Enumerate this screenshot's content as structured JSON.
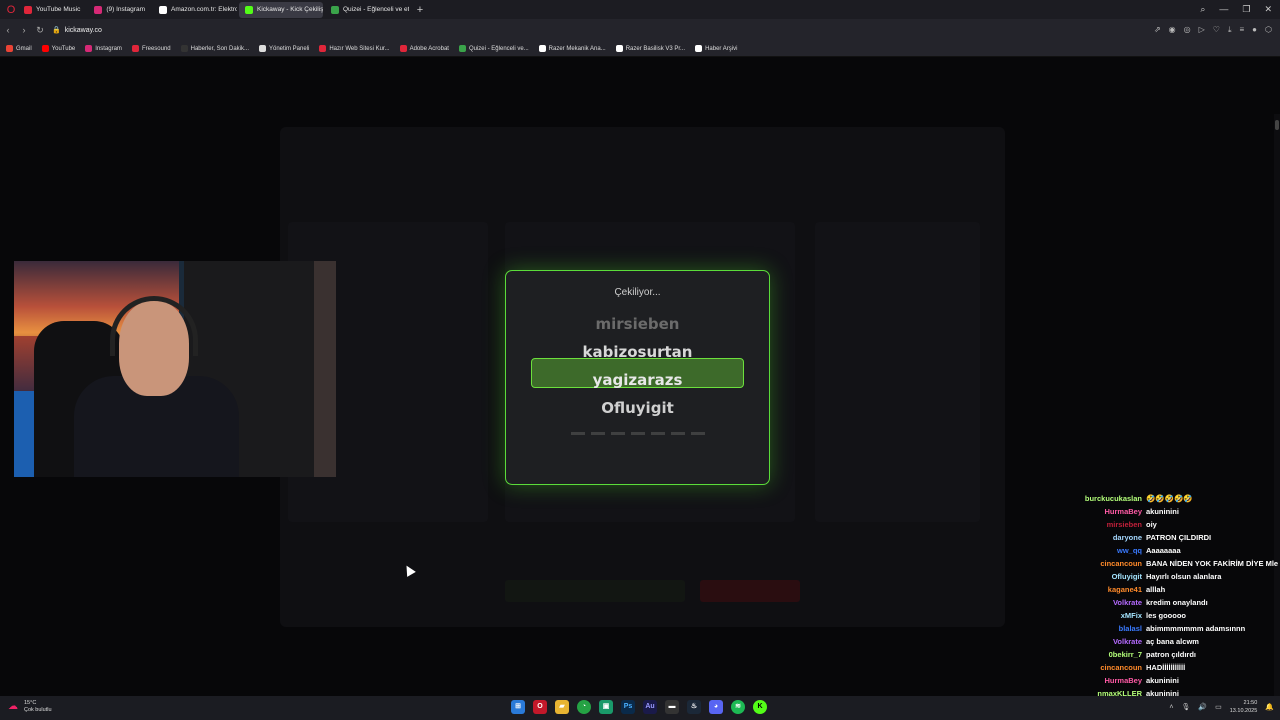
{
  "browser": {
    "tabs": [
      {
        "label": "YouTube Music",
        "color": "#e0263a",
        "active": false
      },
      {
        "label": "(9) Instagram",
        "color": "#d62976",
        "active": false
      },
      {
        "label": "Amazon.com.tr: Elektronik...",
        "color": "#ffffff",
        "active": false
      },
      {
        "label": "Kickaway - Kick Çekiliş Ar...",
        "color": "#53fc18",
        "active": true
      },
      {
        "label": "Quizei - Eğlenceli ve etkile...",
        "color": "#3aa34a",
        "active": false
      }
    ],
    "url": "kickaway.co",
    "bookmarks": [
      {
        "label": "Gmail",
        "color": "#ea4335"
      },
      {
        "label": "YouTube",
        "color": "#ff0000"
      },
      {
        "label": "Instagram",
        "color": "#d62976"
      },
      {
        "label": "Freesound",
        "color": "#e0263a"
      },
      {
        "label": "Haberler, Son Dakik...",
        "color": "#333333"
      },
      {
        "label": "Yönetim Paneli",
        "color": "#dddddd"
      },
      {
        "label": "Hazır Web Sitesi Kur...",
        "color": "#e0263a"
      },
      {
        "label": "Adobe Acrobat",
        "color": "#e0263a"
      },
      {
        "label": "Quizei - Eğlenceli ve...",
        "color": "#3aa34a"
      },
      {
        "label": "Razer Mekanik Ana...",
        "color": "#ffffff"
      },
      {
        "label": "Razer Basilisk V3 Pr...",
        "color": "#ffffff"
      },
      {
        "label": "Haber Arşivi",
        "color": "#ffffff"
      }
    ]
  },
  "modal": {
    "title": "Çekiliyor...",
    "names": [
      "mirsieben",
      "kabizosurtan",
      "yagizarazs",
      "Ofluyigit"
    ],
    "accent": "#5bdc3a"
  },
  "chat": [
    {
      "user": "burckucukaslan",
      "color": "#b4ff7a",
      "msg": "🤣🤣🤣🤣🤣"
    },
    {
      "user": "HurmaBey",
      "color": "#ff5aa5",
      "msg": "akuninini"
    },
    {
      "user": "mirsieben",
      "color": "#c0203a",
      "msg": "oiy"
    },
    {
      "user": "daryone",
      "color": "#a5d8ff",
      "msg": "PATRON ÇILDIRDI"
    },
    {
      "user": "ww_qq",
      "color": "#3a7aff",
      "msg": "Aaaaaaaa"
    },
    {
      "user": "cincancoun",
      "color": "#ff8a2a",
      "msg": "BANA NİDEN YOK FAKİRİM DİYE Mle"
    },
    {
      "user": "Ofluyigit",
      "color": "#a5e5ff",
      "msg": "Hayırlı olsun alanlara"
    },
    {
      "user": "kagane41",
      "color": "#ff8a2a",
      "msg": "alllah"
    },
    {
      "user": "Volkrate",
      "color": "#b46aff",
      "msg": "kredim onaylandı"
    },
    {
      "user": "xMFix",
      "color": "#a5e5ff",
      "msg": "les gooooo"
    },
    {
      "user": "blalasl",
      "color": "#3a7aff",
      "msg": "abimmmmmmm adamsınnn"
    },
    {
      "user": "Volkrate",
      "color": "#b46aff",
      "msg": "aç bana alcwm"
    },
    {
      "user": "0bekirr_7",
      "color": "#b4ff7a",
      "msg": "patron çıldırdı"
    },
    {
      "user": "cincancoun",
      "color": "#ff8a2a",
      "msg": "HADİİİİİİİİİİİ"
    },
    {
      "user": "HurmaBey",
      "color": "#ff5aa5",
      "msg": "akuninini"
    },
    {
      "user": "nmaxKLLER",
      "color": "#b4ff7a",
      "msg": "akuninini"
    }
  ],
  "taskbar": {
    "temp": "15°C",
    "weather": "Çok bulutlu",
    "time": "21:50",
    "date": "13.10.2025"
  }
}
